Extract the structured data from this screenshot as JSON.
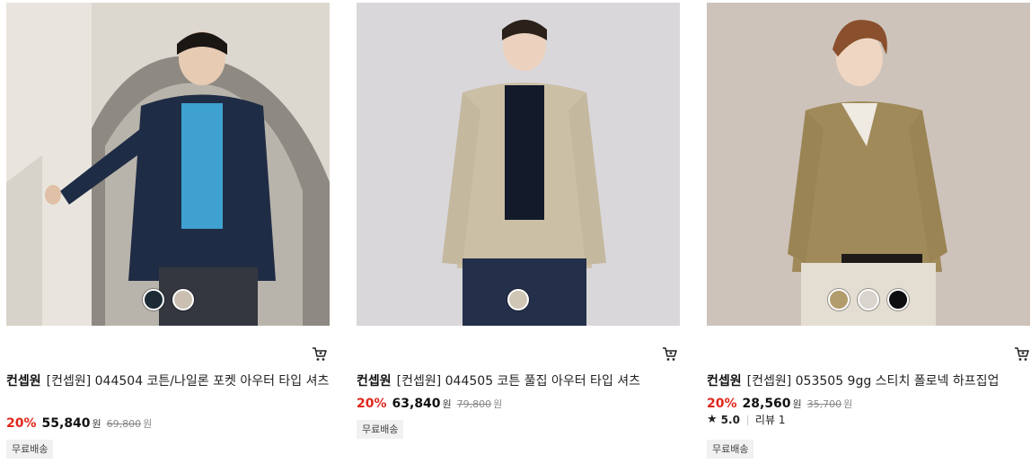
{
  "products": [
    {
      "brand": "컨셉원",
      "name": "[컨셉원] 044504 코튼/나일론 포켓 아우터 타입 셔츠",
      "discount": "20%",
      "price": "55,840",
      "currency": "원",
      "original_price": "69,800",
      "badge": "무료배송",
      "swatches": [
        "#1c2b36",
        "#cbbfb2"
      ],
      "image_alt": "navy jacket model"
    },
    {
      "brand": "컨셉원",
      "name": "[컨셉원] 044505 코튼 풀집 아우터 타입 셔츠",
      "discount": "20%",
      "price": "63,840",
      "currency": "원",
      "original_price": "79,800",
      "badge": "무료배송",
      "swatches": [
        "#cfc6b6"
      ],
      "image_alt": "beige jacket model"
    },
    {
      "brand": "컨셉원",
      "name": "[컨셉원] 053505 9gg 스티치 폴로넥 하프집업",
      "discount": "20%",
      "price": "28,560",
      "currency": "원",
      "original_price": "35,700",
      "rating": "5.0",
      "review": "리뷰 1",
      "badge": "무료배송",
      "swatches": [
        "#b39c6c",
        "#d9d4cd",
        "#0e0e10"
      ],
      "image_alt": "khaki knit model"
    }
  ],
  "colors": {
    "discount": "#e0261b",
    "badge_bg": "#f1f1f1"
  },
  "icons": {
    "cart": "cart-icon",
    "star": "star-icon"
  }
}
